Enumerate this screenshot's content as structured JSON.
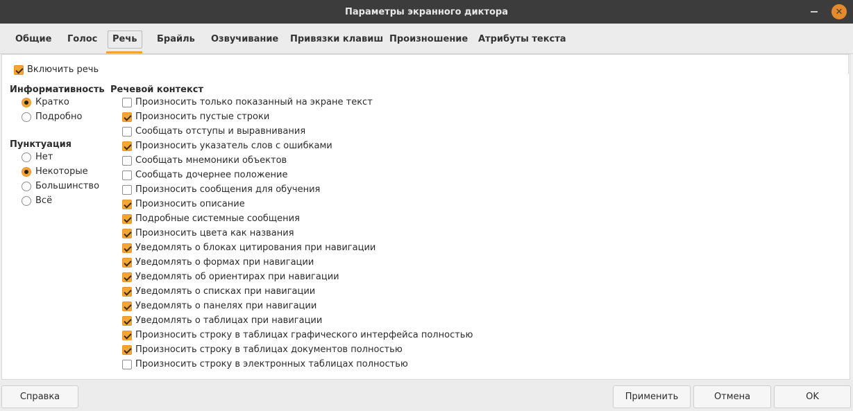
{
  "window": {
    "title": "Параметры экранного диктора",
    "minimize_glyph": "",
    "close_glyph": "✕"
  },
  "tabs": [
    {
      "label": "Общие"
    },
    {
      "label": "Голос"
    },
    {
      "label": "Речь"
    },
    {
      "label": "Брайль"
    },
    {
      "label": "Озвучивание"
    },
    {
      "label": "Привязки клавиш"
    },
    {
      "label": "Произношение"
    },
    {
      "label": "Атрибуты текста"
    }
  ],
  "active_tab": "Речь",
  "enable_speech": {
    "label": "Включить речь",
    "checked": true
  },
  "verbosity": {
    "title": "Информативность",
    "options": [
      {
        "label": "Кратко",
        "selected": true
      },
      {
        "label": "Подробно",
        "selected": false
      }
    ]
  },
  "punctuation": {
    "title": "Пунктуация",
    "options": [
      {
        "label": "Нет",
        "selected": false
      },
      {
        "label": "Некоторые",
        "selected": true
      },
      {
        "label": "Большинство",
        "selected": false
      },
      {
        "label": "Всё",
        "selected": false
      }
    ]
  },
  "speech_context": {
    "title": "Речевой контекст",
    "items": [
      {
        "label": "Произносить только показанный на экране текст",
        "checked": false
      },
      {
        "label": "Произносить пустые строки",
        "checked": true
      },
      {
        "label": "Сообщать отступы и выравнивания",
        "checked": false
      },
      {
        "label": "Произносить указатель слов с ошибками",
        "checked": true
      },
      {
        "label": "Сообщать мнемоники объектов",
        "checked": false
      },
      {
        "label": "Сообщать дочернее положение",
        "checked": false
      },
      {
        "label": "Произносить сообщения для обучения",
        "checked": false
      },
      {
        "label": "Произносить описание",
        "checked": true
      },
      {
        "label": "Подробные системные сообщения",
        "checked": true
      },
      {
        "label": "Произносить цвета как названия",
        "checked": true
      },
      {
        "label": "Уведомлять о блоках цитирования при навигации",
        "checked": true
      },
      {
        "label": "Уведомлять о формах при навигации",
        "checked": true
      },
      {
        "label": "Уведомлять об ориентирах при навигации",
        "checked": true
      },
      {
        "label": "Уведомлять о списках при навигации",
        "checked": true
      },
      {
        "label": "Уведомлять о панелях при навигации",
        "checked": true
      },
      {
        "label": "Уведомлять о таблицах при навигации",
        "checked": true
      },
      {
        "label": "Произносить строку в таблицах графического интерфейса полностью",
        "checked": true
      },
      {
        "label": "Произносить строку в таблицах документов полностью",
        "checked": true
      },
      {
        "label": "Произносить строку в электронных таблицах полностью",
        "checked": false
      }
    ]
  },
  "buttons": {
    "help": "Справка",
    "apply": "Применить",
    "cancel": "Отмена",
    "ok": "OK"
  },
  "colors": {
    "accent": "#f4a534",
    "titlebar": "#3c3c3c",
    "close_button": "#e6892b"
  }
}
